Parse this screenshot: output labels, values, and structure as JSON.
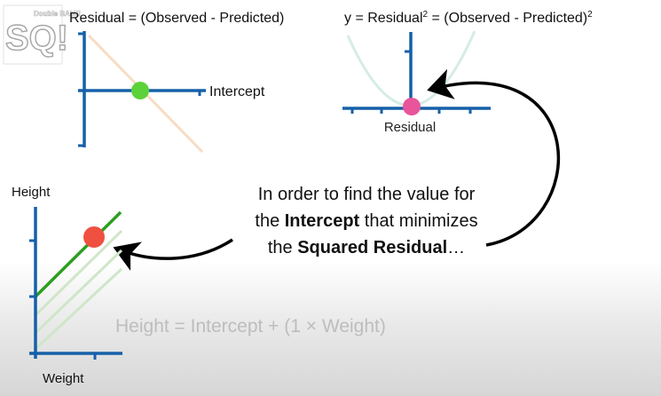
{
  "logo": {
    "text": "SQ!",
    "subtext": "Double BAM!!"
  },
  "residual_plot": {
    "title": "Residual = (Observed - Predicted)",
    "x_label": "Intercept",
    "colors": {
      "axis": "#1560a8",
      "line": "#f7dcc4",
      "point": "#5bd23a"
    }
  },
  "squared_plot": {
    "title_prefix": "y = Residual",
    "title_sup1": "2",
    "title_mid": " = (Observed - Predicted)",
    "title_sup2": "2",
    "x_label": "Residual",
    "colors": {
      "axis": "#1560a8",
      "curve": "#d6ece6",
      "point": "#e8559b"
    }
  },
  "explanation": {
    "line1": "In order to find the value for",
    "line2_a": "the ",
    "line2_b": "Intercept",
    "line2_c": " that minimizes",
    "line3_a": "the ",
    "line3_b": "Squared Residual",
    "line3_c": "…"
  },
  "fit_plot": {
    "y_label": "Height",
    "x_label": "Weight",
    "equation": "Height = Intercept + (1 × Weight)",
    "colors": {
      "axis": "#1560a8",
      "line": "#2c9e1f",
      "faded": "#cfe6c8",
      "point": "#f05040"
    }
  }
}
